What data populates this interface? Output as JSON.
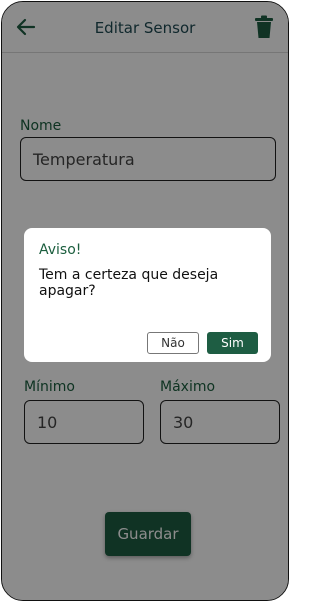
{
  "header": {
    "title": "Editar Sensor",
    "back_icon": "arrow-left-icon",
    "delete_icon": "trash-icon"
  },
  "form": {
    "name_label": "Nome",
    "name_value": "Temperatura",
    "min_label": "Mínimo",
    "min_value": "10",
    "max_label": "Máximo",
    "max_value": "30",
    "save_label": "Guardar"
  },
  "dialog": {
    "title": "Aviso!",
    "message": "Tem a certeza que deseja apagar?",
    "no_label": "Não",
    "yes_label": "Sim"
  },
  "colors": {
    "accent": "#1e5d43",
    "title_text": "#1e4a52",
    "overlay": "rgba(0,0,0,0.45)"
  }
}
